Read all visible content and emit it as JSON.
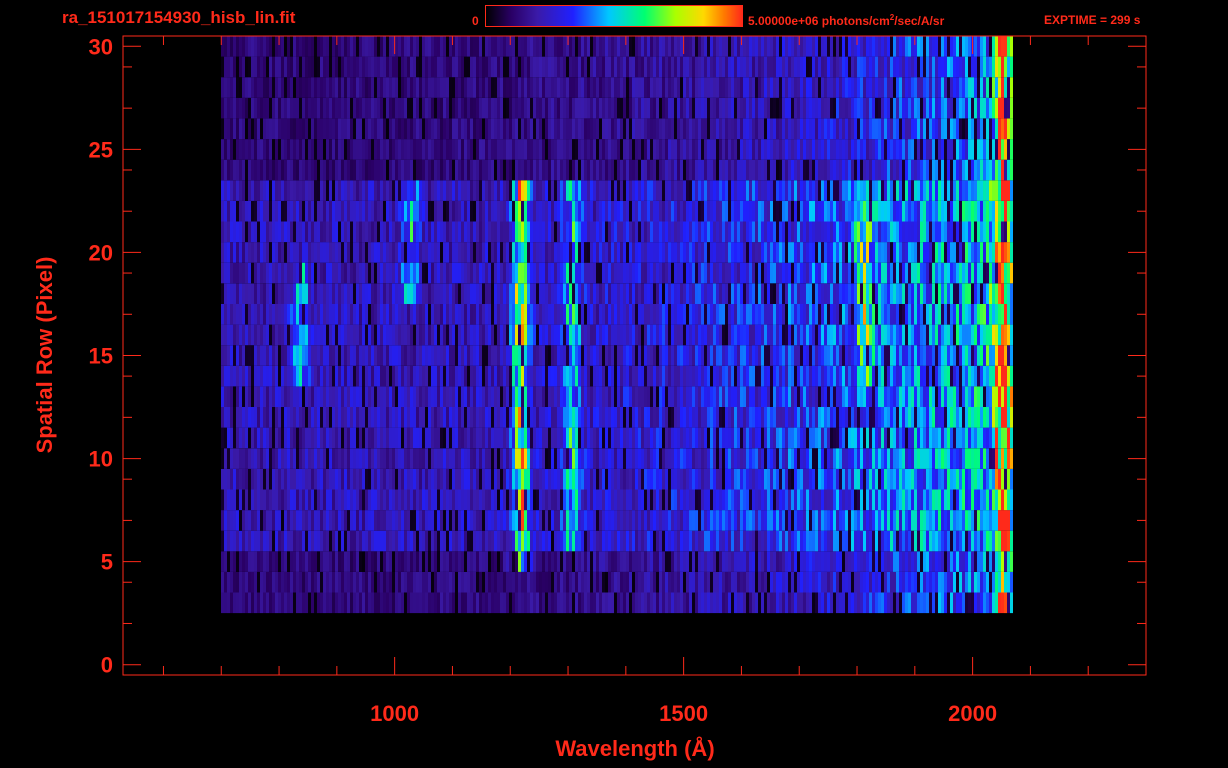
{
  "header": {
    "file_title": "ra_151017154930_hisb_lin.fit",
    "colorbar_min": "0",
    "colorbar_max_prefix": "5.00000e+06 photons/cm",
    "colorbar_max_exp": "2",
    "colorbar_max_suffix": "/sec/A/sr",
    "exptime": "EXPTIME = 299 s"
  },
  "colors": {
    "axis": "#ff2a1a",
    "background": "#000000"
  },
  "chart_data": {
    "type": "heatmap",
    "title": "ra_151017154930_hisb_lin.fit",
    "xlabel": "Wavelength (Å)",
    "ylabel": "Spatial Row (Pixel)",
    "xlim": [
      530,
      2300
    ],
    "ylim": [
      -0.5,
      30.5
    ],
    "x_ticks": [
      1000,
      1500,
      2000
    ],
    "y_ticks": [
      0,
      5,
      10,
      15,
      20,
      25,
      30
    ],
    "colorbar": {
      "min": 0,
      "max": 5000000,
      "units": "photons/cm^2/sec/A/sr",
      "scale": "linear"
    },
    "data_extent": {
      "x": [
        700,
        2070
      ],
      "y": [
        3,
        30
      ]
    },
    "bright_region_rows": [
      6,
      23
    ],
    "emission_features": [
      {
        "wavelength": 835,
        "rows": [
          14,
          19
        ],
        "level": "medium"
      },
      {
        "wavelength": 1025,
        "rows": [
          18,
          23
        ],
        "level": "medium"
      },
      {
        "wavelength": 1216,
        "rows": [
          5,
          23
        ],
        "level": "high"
      },
      {
        "wavelength": 1304,
        "rows": [
          6,
          23
        ],
        "level": "medium"
      },
      {
        "wavelength": 1810,
        "rows": [
          14,
          23
        ],
        "level": "medium"
      },
      {
        "wavelength": 2050,
        "rows": [
          3,
          30
        ],
        "level": "high"
      }
    ]
  }
}
